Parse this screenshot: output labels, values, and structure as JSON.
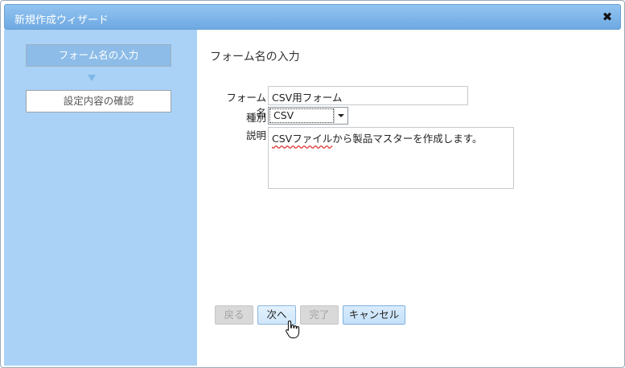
{
  "window": {
    "title": "新規作成ウィザード",
    "close_glyph": "✖"
  },
  "sidebar": {
    "steps": [
      {
        "label": "フォーム名の入力",
        "state": "active"
      },
      {
        "label": "設定内容の確認",
        "state": "pending"
      }
    ]
  },
  "main": {
    "heading": "フォーム名の入力",
    "form": {
      "name_label": "フォーム名",
      "name_value": "CSV用フォーム",
      "type_label": "種別",
      "type_value": "CSV",
      "description_label": "説明",
      "description_value_underlined": "CSVファイル",
      "description_value_rest": "から製品マスターを作成します。"
    },
    "buttons": {
      "back": "戻る",
      "next": "次へ",
      "finish": "完了",
      "cancel": "キャンセル"
    }
  },
  "colors": {
    "titlebar": "#7fb6e8",
    "sidebar": "#a9d2f6",
    "active_step": "#8dbce8",
    "primary_button": "#cfe6fa"
  }
}
